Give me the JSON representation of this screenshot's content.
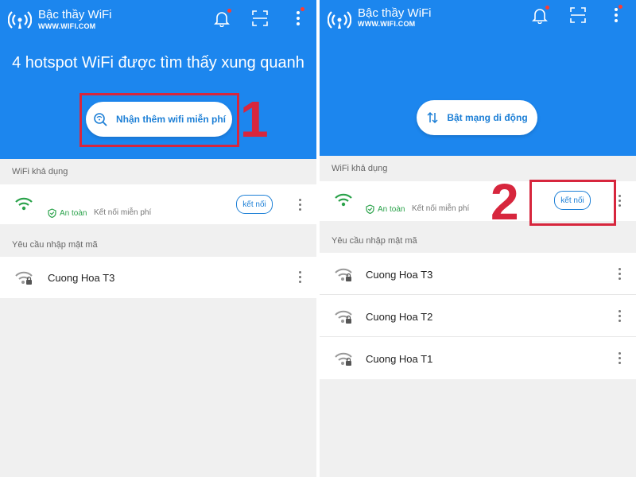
{
  "left": {
    "app_title": "Bậc thầy WiFi",
    "app_url": "WWW.WIFI.COM",
    "headline": "4 hotspot WiFi được tìm thấy xung quanh",
    "primary_button": "Nhận thêm wifi miễn phí",
    "available_label": "WiFi khả dụng",
    "available": {
      "safe_label": "An toàn",
      "free_label": "Kết nối miễn phí",
      "connect_label": "kết nối"
    },
    "password_label": "Yêu cầu nhập mật mã",
    "password_networks": [
      "Cuong Hoa T3"
    ],
    "step_number": "1"
  },
  "right": {
    "app_title": "Bậc thầy WiFi",
    "app_url": "WWW.WIFI.COM",
    "primary_button": "Bật mạng di động",
    "available_label": "WiFi khả dụng",
    "available": {
      "safe_label": "An toàn",
      "free_label": "Kết nối miễn phí",
      "connect_label": "kết nối"
    },
    "password_label": "Yêu cầu nhập mật mã",
    "password_networks": [
      "Cuong Hoa T3",
      "Cuong Hoa T2",
      "Cuong Hoa T1"
    ],
    "step_number": "2"
  },
  "icons": [
    "wifi-logo-icon",
    "bell-icon",
    "scan-icon",
    "more-vert-icon",
    "search-wifi-icon",
    "mobile-data-icon",
    "wifi-signal-icon",
    "wifi-locked-icon",
    "shield-check-icon"
  ],
  "colors": {
    "header": "#1c86ee",
    "accent": "#1c7fd6",
    "safe": "#2aa24a",
    "annotation": "#d7263d",
    "notification_dot": "#ff3b30"
  }
}
